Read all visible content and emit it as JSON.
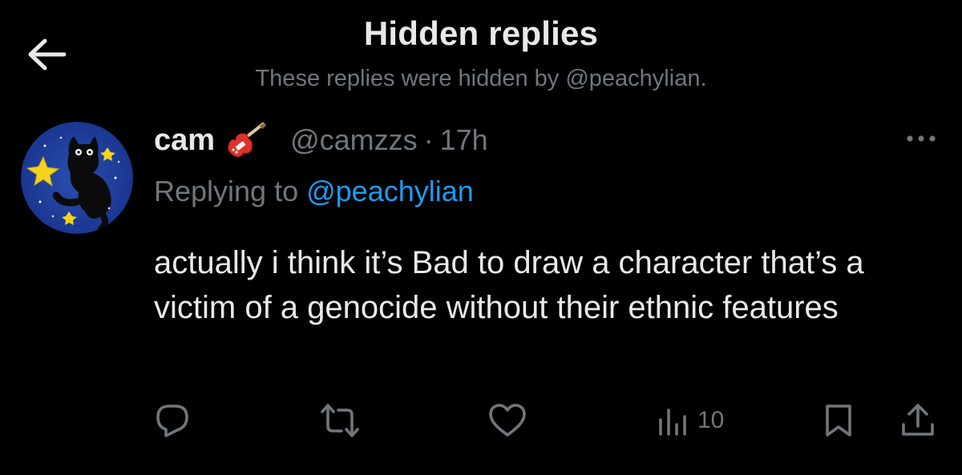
{
  "header": {
    "back_icon": "arrow-left-icon",
    "title": "Hidden replies",
    "subtitle": "These replies were hidden by @peachylian."
  },
  "tweet": {
    "author_name": "cam",
    "author_emoji_icon": "guitar-icon",
    "handle": "@camzzs",
    "separator": "·",
    "time": "17h",
    "replying_prefix": "Replying to ",
    "replying_mention": "@peachylian",
    "text": "actually i think it’s Bad to draw a character that’s a victim of a genocide without their ethnic features",
    "actions": {
      "reply_icon": "reply-icon",
      "retweet_icon": "retweet-icon",
      "like_icon": "heart-icon",
      "views_icon": "views-icon",
      "views_count": "10",
      "bookmark_icon": "bookmark-icon",
      "share_icon": "share-icon"
    }
  },
  "colors": {
    "background": "#000000",
    "primary_text": "#e7e9ea",
    "secondary_text": "#71767b",
    "link": "#1d9bf0"
  }
}
